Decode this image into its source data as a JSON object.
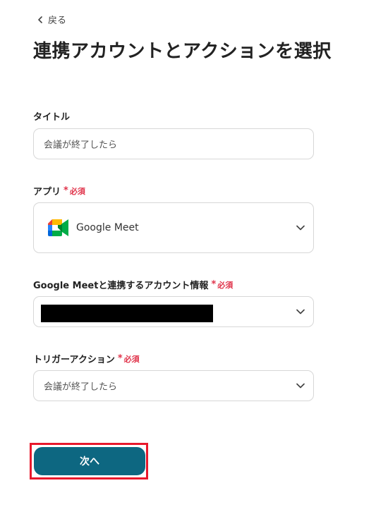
{
  "nav": {
    "back_label": "戻る"
  },
  "page": {
    "title": "連携アカウントとアクションを選択"
  },
  "fields": {
    "title": {
      "label": "タイトル",
      "value": "会議が終了したら"
    },
    "app": {
      "label": "アプリ",
      "required_mark": "*",
      "required_text": "必須",
      "value": "Google Meet",
      "icon": "google-meet-icon"
    },
    "account": {
      "label": "Google Meetと連携するアカウント情報",
      "required_mark": "*",
      "required_text": "必須",
      "value_redacted": true
    },
    "trigger": {
      "label": "トリガーアクション",
      "required_mark": "*",
      "required_text": "必須",
      "value": "会議が終了したら"
    }
  },
  "actions": {
    "next_label": "次へ"
  },
  "colors": {
    "primary": "#0d6781",
    "required": "#e0334a",
    "highlight": "#e8192c"
  }
}
